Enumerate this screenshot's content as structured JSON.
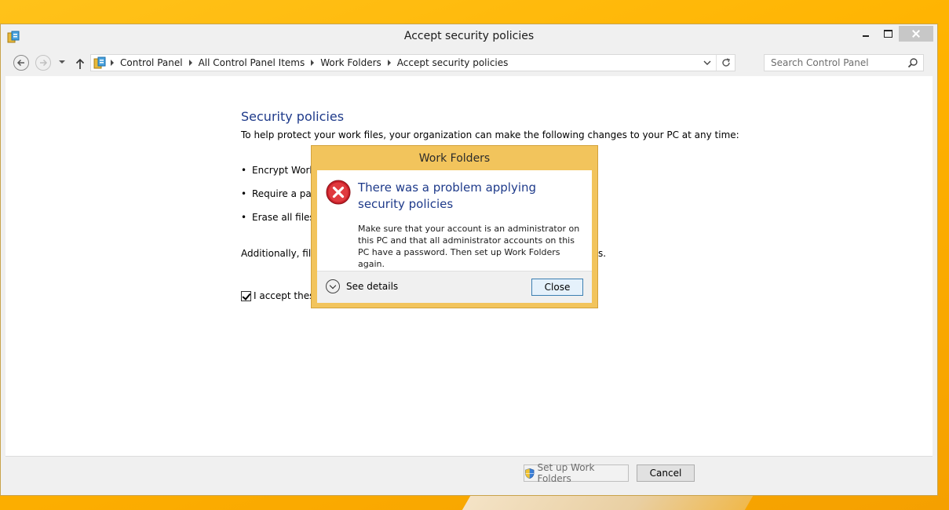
{
  "window": {
    "title": "Accept security policies"
  },
  "address": {
    "crumbs": [
      "Control Panel",
      "All Control Panel Items",
      "Work Folders",
      "Accept security policies"
    ]
  },
  "search": {
    "placeholder": "Search Control Panel"
  },
  "content": {
    "heading": "Security policies",
    "intro": "To help protect your work files, your organization can make the following changes to your PC at any time:",
    "bullets": [
      "Encrypt Work F",
      "Require a pass",
      "Erase all files in"
    ],
    "additional_prefix": "Additionally, files",
    "additional_suffix": "s.",
    "accept_label": "I accept these"
  },
  "footer": {
    "setup_label": "Set up Work Folders",
    "cancel_label": "Cancel"
  },
  "dialog": {
    "title": "Work Folders",
    "main_instruction": "There was a problem applying security policies",
    "content": "Make sure that your account is an administrator on this PC and that all administrator accounts on this PC have a password. Then set up Work Folders again.",
    "details_label": "See details",
    "close_label": "Close"
  },
  "colors": {
    "accent_heading": "#1e3a8a",
    "dialog_frame": "#f2c45c",
    "desktop": "#ffb300"
  },
  "icons": [
    "control-panel-icon",
    "back-icon",
    "forward-icon",
    "up-arrow-icon",
    "refresh-icon",
    "search-icon",
    "error-icon",
    "shield-icon",
    "expand-icon"
  ]
}
